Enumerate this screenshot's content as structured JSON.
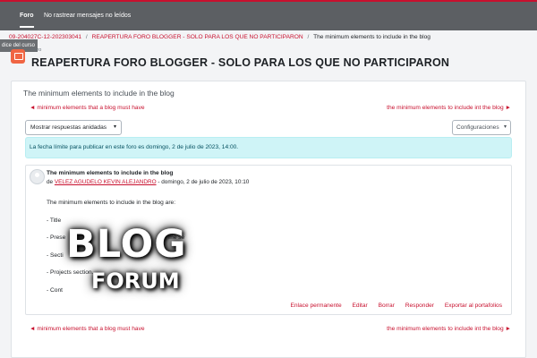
{
  "topbar": {
    "tab_forum": "Foro",
    "tab_untrack": "No rastrear mensajes no leídos"
  },
  "course_index": "dice del curso",
  "breadcrumb": {
    "items": [
      "09-204027C-12-202303041",
      "REAPERTURA FORO BLOGGER - SOLO PARA LOS QUE NO PARTICIPARON",
      "The minimum elements to include in the blog"
    ]
  },
  "forum": {
    "label": "Foro",
    "title": "REAPERTURA FORO BLOGGER - SOLO PARA LOS QUE NO PARTICIPARON"
  },
  "discussion": {
    "title": "The minimum elements to include in the blog",
    "prev_link": "◄ minimum elements that a blog must have",
    "next_link": "the minimum elements to include int the blog ►",
    "display_mode": "Mostrar respuestas anidadas",
    "settings_label": "Configuraciones",
    "due_notice": "La fecha límite para publicar en este foro es domingo, 2 de julio de 2023, 14:00."
  },
  "post": {
    "subject": "The minimum elements to include in the blog",
    "by_prefix": "de",
    "author": "VELEZ AGUDELO KEVIN ALEJANDRO",
    "date_suffix": " - domingo, 2 de julio de 2023, 10:10",
    "body": {
      "intro": "The minimum elements to include in the blog are:",
      "item1": "- Title",
      "item2": "- Prese",
      "item2_tail": "me se",
      "item3": "- Secti",
      "item4": "- Projects section.",
      "item5": "- Cont"
    },
    "actions": [
      "Enlace permanente",
      "Editar",
      "Borrar",
      "Responder",
      "Exportar al portafolios"
    ]
  },
  "overlay": {
    "big": "BLOG",
    "small": "FORUM"
  },
  "colors": {
    "brand": "#c8102e",
    "forum_icon": "#f06543",
    "alert_bg": "#cff4f7"
  }
}
